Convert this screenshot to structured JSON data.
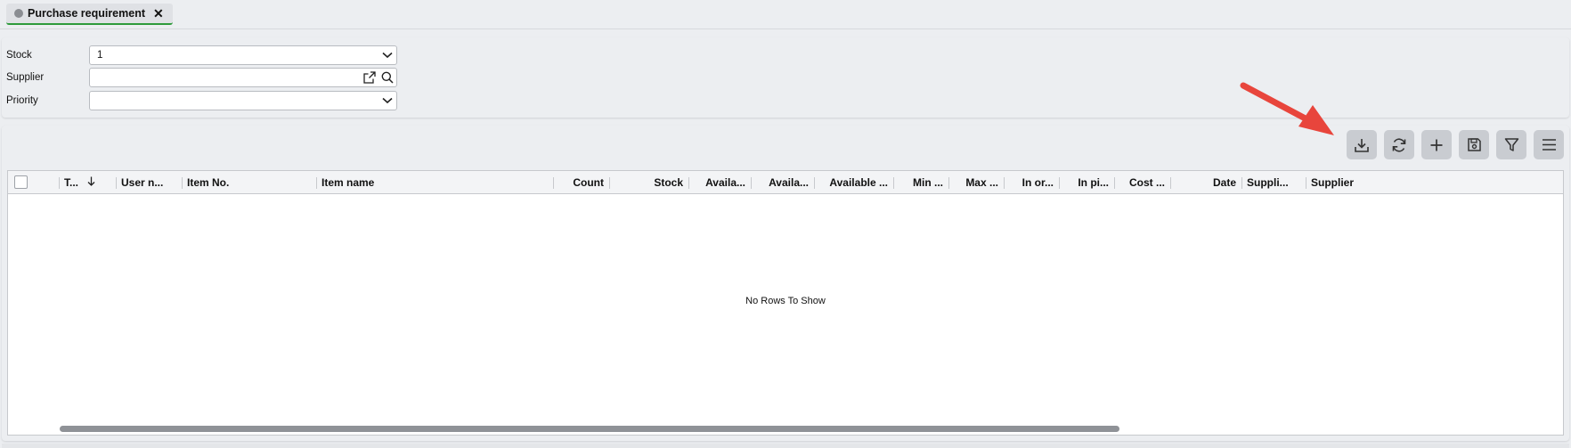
{
  "tab": {
    "title": "Purchase requirement",
    "close": "✕"
  },
  "filters": {
    "stock": {
      "label": "Stock",
      "value": "1"
    },
    "supplier": {
      "label": "Supplier",
      "value": ""
    },
    "priority": {
      "label": "Priority",
      "value": ""
    }
  },
  "toolbar": [
    "download-icon",
    "refresh-icon",
    "plus-icon",
    "save-icon",
    "filter-icon",
    "menu-icon"
  ],
  "grid": {
    "columns": [
      "T...",
      "User n...",
      "Item No.",
      "Item name",
      "Count",
      "Stock",
      "Availa...",
      "Availa...",
      "Available ...",
      "Min ...",
      "Max ...",
      "In or...",
      "In pi...",
      "Cost ...",
      "Date",
      "Suppli...",
      "Supplier"
    ],
    "empty_text": "No Rows To Show"
  },
  "colors": {
    "accent": "#2e9a3b",
    "arrow": "#e8453c"
  }
}
